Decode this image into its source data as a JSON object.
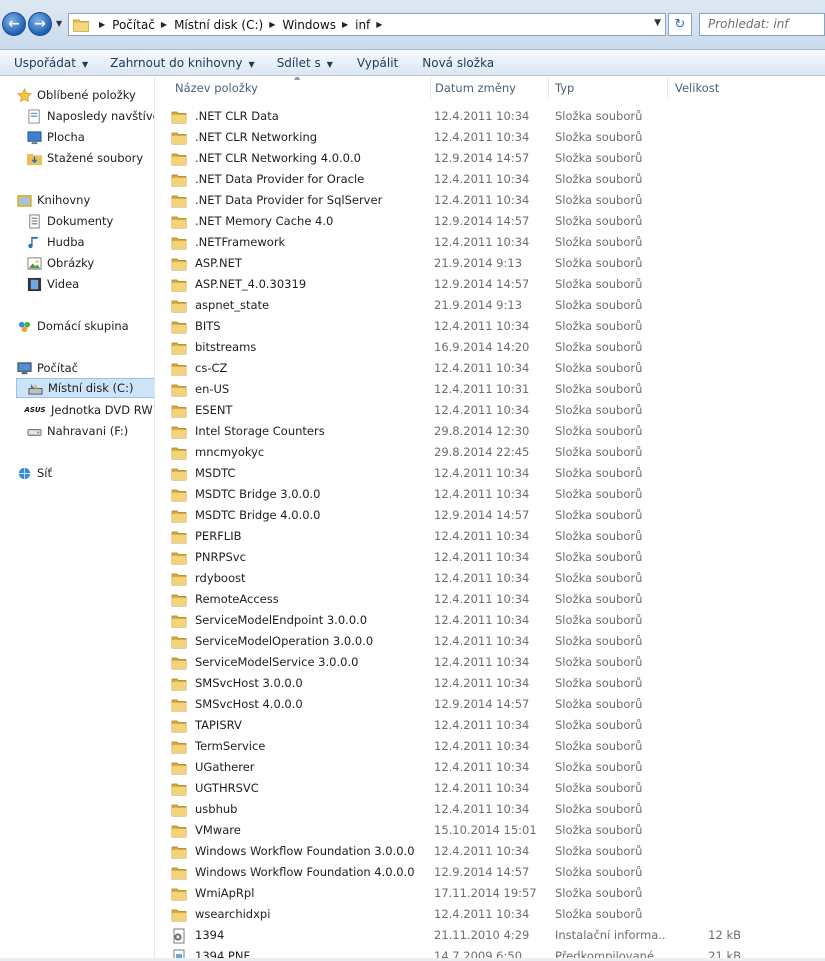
{
  "address": {
    "crumbs": [
      "Počítač",
      "Místní disk (C:)",
      "Windows",
      "inf"
    ],
    "search_placeholder": "Prohledat: inf"
  },
  "toolbar": {
    "organize": "Uspořádat",
    "include": "Zahrnout do knihovny",
    "share": "Sdílet s",
    "burn": "Vypálit",
    "new_folder": "Nová složka"
  },
  "nav": {
    "favorites": "Oblíbené položky",
    "recent": "Naposledy navštíver",
    "desktop": "Plocha",
    "downloads": "Stažené soubory",
    "libraries": "Knihovny",
    "documents": "Dokumenty",
    "music": "Hudba",
    "pictures": "Obrázky",
    "videos": "Videa",
    "homegroup": "Domácí skupina",
    "computer": "Počítač",
    "local_disk": "Místní disk (C:)",
    "dvd": "Jednotka DVD RW (D",
    "asus_badge": "ASUS",
    "usb": "Nahravani (F:)",
    "network": "Síť"
  },
  "columns": {
    "name": "Název položky",
    "date": "Datum změny",
    "type": "Typ",
    "size": "Velikost"
  },
  "colors": {
    "folder": "#e8c15a",
    "selection": "#cde3f8",
    "header_text": "#4c607a"
  },
  "files": [
    {
      "name": ".NET CLR Data",
      "date": "12.4.2011 10:34",
      "type": "Složka souborů",
      "size": "",
      "icon": "folder-icon"
    },
    {
      "name": ".NET CLR Networking",
      "date": "12.4.2011 10:34",
      "type": "Složka souborů",
      "size": "",
      "icon": "folder-icon"
    },
    {
      "name": ".NET CLR Networking 4.0.0.0",
      "date": "12.9.2014 14:57",
      "type": "Složka souborů",
      "size": "",
      "icon": "folder-icon"
    },
    {
      "name": ".NET Data Provider for Oracle",
      "date": "12.4.2011 10:34",
      "type": "Složka souborů",
      "size": "",
      "icon": "folder-icon"
    },
    {
      "name": ".NET Data Provider for SqlServer",
      "date": "12.4.2011 10:34",
      "type": "Složka souborů",
      "size": "",
      "icon": "folder-icon"
    },
    {
      "name": ".NET Memory Cache 4.0",
      "date": "12.9.2014 14:57",
      "type": "Složka souborů",
      "size": "",
      "icon": "folder-icon"
    },
    {
      "name": ".NETFramework",
      "date": "12.4.2011 10:34",
      "type": "Složka souborů",
      "size": "",
      "icon": "folder-icon"
    },
    {
      "name": "ASP.NET",
      "date": "21.9.2014 9:13",
      "type": "Složka souborů",
      "size": "",
      "icon": "folder-icon"
    },
    {
      "name": "ASP.NET_4.0.30319",
      "date": "12.9.2014 14:57",
      "type": "Složka souborů",
      "size": "",
      "icon": "folder-icon"
    },
    {
      "name": "aspnet_state",
      "date": "21.9.2014 9:13",
      "type": "Složka souborů",
      "size": "",
      "icon": "folder-icon"
    },
    {
      "name": "BITS",
      "date": "12.4.2011 10:34",
      "type": "Složka souborů",
      "size": "",
      "icon": "folder-icon"
    },
    {
      "name": "bitstreams",
      "date": "16.9.2014 14:20",
      "type": "Složka souborů",
      "size": "",
      "icon": "folder-icon"
    },
    {
      "name": "cs-CZ",
      "date": "12.4.2011 10:34",
      "type": "Složka souborů",
      "size": "",
      "icon": "folder-icon"
    },
    {
      "name": "en-US",
      "date": "12.4.2011 10:31",
      "type": "Složka souborů",
      "size": "",
      "icon": "folder-icon"
    },
    {
      "name": "ESENT",
      "date": "12.4.2011 10:34",
      "type": "Složka souborů",
      "size": "",
      "icon": "folder-icon"
    },
    {
      "name": "Intel Storage Counters",
      "date": "29.8.2014 12:30",
      "type": "Složka souborů",
      "size": "",
      "icon": "folder-icon"
    },
    {
      "name": "mncmyokyc",
      "date": "29.8.2014 22:45",
      "type": "Složka souborů",
      "size": "",
      "icon": "folder-icon"
    },
    {
      "name": "MSDTC",
      "date": "12.4.2011 10:34",
      "type": "Složka souborů",
      "size": "",
      "icon": "folder-icon"
    },
    {
      "name": "MSDTC Bridge 3.0.0.0",
      "date": "12.4.2011 10:34",
      "type": "Složka souborů",
      "size": "",
      "icon": "folder-icon"
    },
    {
      "name": "MSDTC Bridge 4.0.0.0",
      "date": "12.9.2014 14:57",
      "type": "Složka souborů",
      "size": "",
      "icon": "folder-icon"
    },
    {
      "name": "PERFLIB",
      "date": "12.4.2011 10:34",
      "type": "Složka souborů",
      "size": "",
      "icon": "folder-icon"
    },
    {
      "name": "PNRPSvc",
      "date": "12.4.2011 10:34",
      "type": "Složka souborů",
      "size": "",
      "icon": "folder-icon"
    },
    {
      "name": "rdyboost",
      "date": "12.4.2011 10:34",
      "type": "Složka souborů",
      "size": "",
      "icon": "folder-icon"
    },
    {
      "name": "RemoteAccess",
      "date": "12.4.2011 10:34",
      "type": "Složka souborů",
      "size": "",
      "icon": "folder-icon"
    },
    {
      "name": "ServiceModelEndpoint 3.0.0.0",
      "date": "12.4.2011 10:34",
      "type": "Složka souborů",
      "size": "",
      "icon": "folder-icon"
    },
    {
      "name": "ServiceModelOperation 3.0.0.0",
      "date": "12.4.2011 10:34",
      "type": "Složka souborů",
      "size": "",
      "icon": "folder-icon"
    },
    {
      "name": "ServiceModelService 3.0.0.0",
      "date": "12.4.2011 10:34",
      "type": "Složka souborů",
      "size": "",
      "icon": "folder-icon"
    },
    {
      "name": "SMSvcHost 3.0.0.0",
      "date": "12.4.2011 10:34",
      "type": "Složka souborů",
      "size": "",
      "icon": "folder-icon"
    },
    {
      "name": "SMSvcHost 4.0.0.0",
      "date": "12.9.2014 14:57",
      "type": "Složka souborů",
      "size": "",
      "icon": "folder-icon"
    },
    {
      "name": "TAPISRV",
      "date": "12.4.2011 10:34",
      "type": "Složka souborů",
      "size": "",
      "icon": "folder-icon"
    },
    {
      "name": "TermService",
      "date": "12.4.2011 10:34",
      "type": "Složka souborů",
      "size": "",
      "icon": "folder-icon"
    },
    {
      "name": "UGatherer",
      "date": "12.4.2011 10:34",
      "type": "Složka souborů",
      "size": "",
      "icon": "folder-icon"
    },
    {
      "name": "UGTHRSVC",
      "date": "12.4.2011 10:34",
      "type": "Složka souborů",
      "size": "",
      "icon": "folder-icon"
    },
    {
      "name": "usbhub",
      "date": "12.4.2011 10:34",
      "type": "Složka souborů",
      "size": "",
      "icon": "folder-icon"
    },
    {
      "name": "VMware",
      "date": "15.10.2014 15:01",
      "type": "Složka souborů",
      "size": "",
      "icon": "folder-icon"
    },
    {
      "name": "Windows Workflow Foundation 3.0.0.0",
      "date": "12.4.2011 10:34",
      "type": "Složka souborů",
      "size": "",
      "icon": "folder-icon"
    },
    {
      "name": "Windows Workflow Foundation 4.0.0.0",
      "date": "12.9.2014 14:57",
      "type": "Složka souborů",
      "size": "",
      "icon": "folder-icon"
    },
    {
      "name": "WmiApRpl",
      "date": "17.11.2014 19:57",
      "type": "Složka souborů",
      "size": "",
      "icon": "folder-icon"
    },
    {
      "name": "wsearchidxpi",
      "date": "12.4.2011 10:34",
      "type": "Složka souborů",
      "size": "",
      "icon": "folder-icon"
    },
    {
      "name": "1394",
      "date": "21.11.2010 4:29",
      "type": "Instalační informa...",
      "size": "12 kB",
      "icon": "setup-info-file-icon"
    },
    {
      "name": "1394.PNF",
      "date": "14.7.2009 6:50",
      "type": "Předkompilované ...",
      "size": "21 kB",
      "icon": "pnf-file-icon"
    }
  ]
}
